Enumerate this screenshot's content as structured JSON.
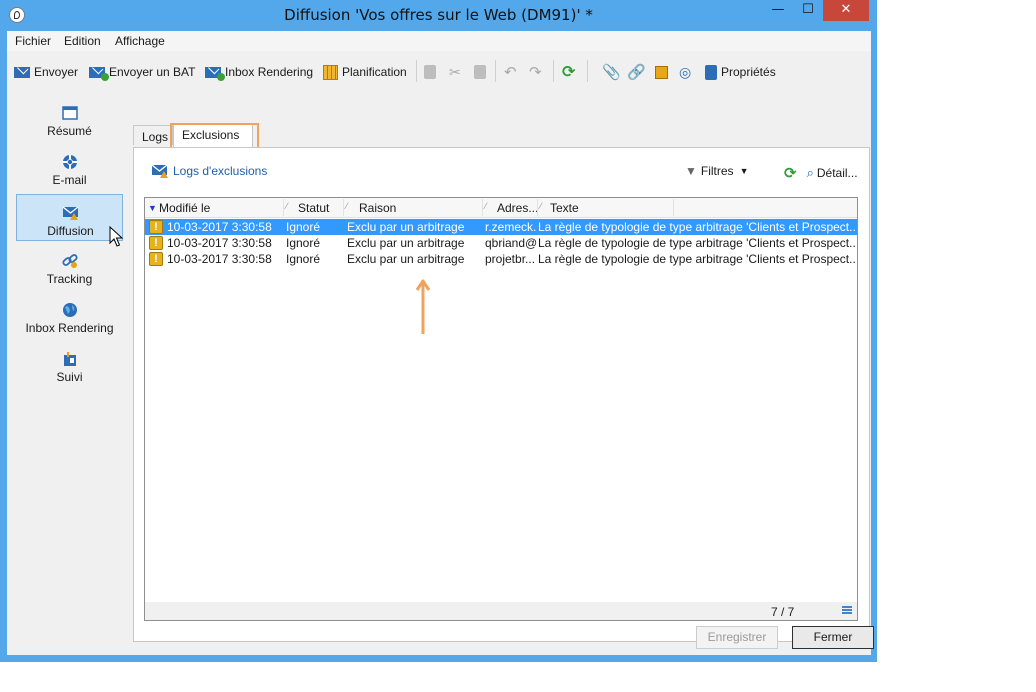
{
  "window": {
    "title": "Diffusion 'Vos offres sur le Web (DM91)' *",
    "buttons": {
      "minimize": "—",
      "maximize": "☐",
      "close": "✕"
    }
  },
  "menu": [
    "Fichier",
    "Edition",
    "Affichage"
  ],
  "toolbar": {
    "send": "Envoyer",
    "send_bat": "Envoyer un BAT",
    "inbox_rendering": "Inbox Rendering",
    "planning": "Planification",
    "properties": "Propriétés"
  },
  "nav": [
    {
      "label": "Résumé",
      "icon": "window-icon"
    },
    {
      "label": "E-mail",
      "icon": "lifebuoy-icon"
    },
    {
      "label": "Diffusion",
      "icon": "mail-warning-icon",
      "active": true
    },
    {
      "label": "Tracking",
      "icon": "chain-link-icon"
    },
    {
      "label": "Inbox Rendering",
      "icon": "globe-icon"
    },
    {
      "label": "Suivi",
      "icon": "flag-icon"
    }
  ],
  "tabs": [
    "Logs",
    "Exclusions"
  ],
  "subbar": {
    "logs_link": "Logs d'exclusions",
    "filters": "Filtres",
    "detail": "Détail..."
  },
  "grid": {
    "columns": [
      "Modifié le",
      "Statut",
      "Raison",
      "Adres...",
      "Texte"
    ],
    "rows": [
      {
        "date": "10-03-2017 3:30:58",
        "status": "Ignoré",
        "reason": "Exclu par un arbitrage",
        "address": "r.zemeck.",
        "text": "La règle de typologie de type arbitrage 'Clients et Prospect...",
        "selected": true
      },
      {
        "date": "10-03-2017 3:30:58",
        "status": "Ignoré",
        "reason": "Exclu par un arbitrage",
        "address": "qbriand@",
        "text": "La règle de typologie de type arbitrage 'Clients et Prospect..."
      },
      {
        "date": "10-03-2017 3:30:58",
        "status": "Ignoré",
        "reason": "Exclu par un arbitrage",
        "address": "projetbr...",
        "text": "La règle de typologie de type arbitrage 'Clients et Prospect..."
      }
    ],
    "count": "7 / 7"
  },
  "footer": {
    "save": "Enregistrer",
    "close": "Fermer"
  },
  "colors": {
    "frame": "#53a8ec",
    "selection": "#3399ff",
    "highlight": "#f0a35c",
    "close_button": "#c7483a"
  }
}
